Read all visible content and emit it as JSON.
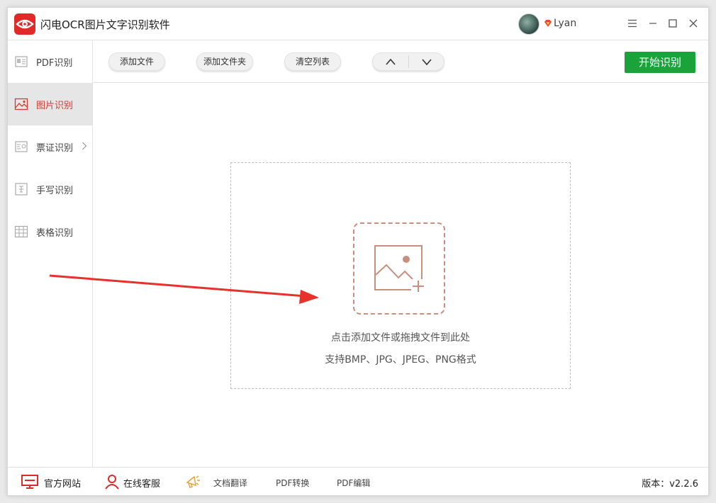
{
  "window": {
    "title": "闪电OCR图片文字识别软件",
    "username": "Lyan"
  },
  "sidebar": {
    "items": [
      {
        "label": "PDF识别",
        "icon": "pdf-doc-icon"
      },
      {
        "label": "图片识别",
        "icon": "image-icon",
        "active": true
      },
      {
        "label": "票证识别",
        "icon": "ticket-icon",
        "has_submenu": true
      },
      {
        "label": "手写识别",
        "icon": "handwriting-icon"
      },
      {
        "label": "表格识别",
        "icon": "table-icon"
      }
    ]
  },
  "toolbar": {
    "add_file": "添加文件",
    "add_folder": "添加文件夹",
    "clear_list": "清空列表",
    "start": "开始识别"
  },
  "dropzone": {
    "hint": "点击添加文件或拖拽文件到此处",
    "formats": "支持BMP、JPG、JPEG、PNG格式"
  },
  "footer": {
    "website": "官方网站",
    "support": "在线客服",
    "translate": "文档翻译",
    "pdf_convert": "PDF转换",
    "pdf_edit": "PDF编辑",
    "version": "版本：v2.2.6"
  },
  "colors": {
    "brand_red": "#e02929",
    "active_text": "#d43b2e",
    "start_green": "#1aa23b",
    "drop_icon": "#c98f7c",
    "annotation_arrow": "#e8312a"
  }
}
